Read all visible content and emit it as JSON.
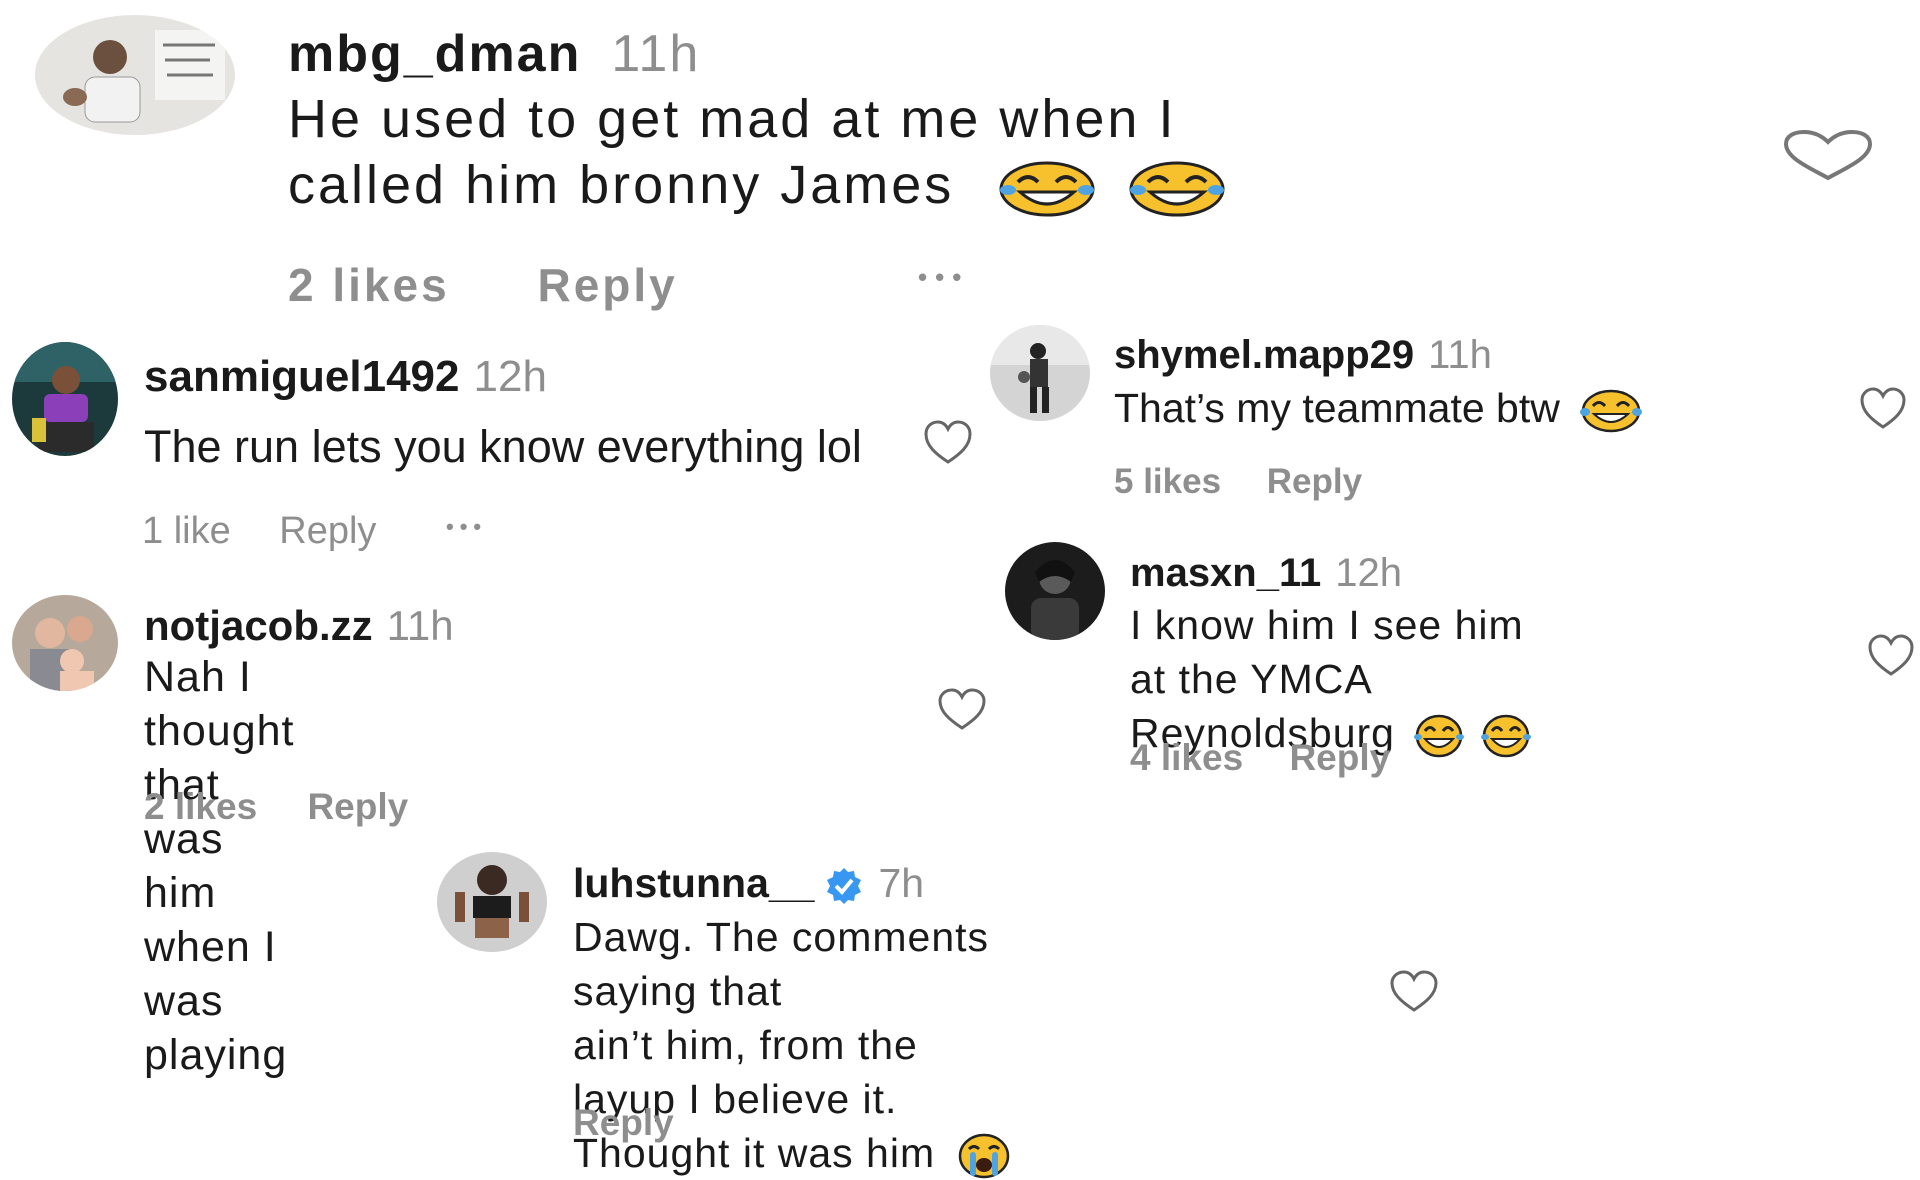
{
  "colors": {
    "text": "#1a1a1a",
    "muted": "#8e8e8e",
    "verified": "#3897f0",
    "emoji_face": "#f6c12d",
    "emoji_tears": "#4fa3e0"
  },
  "icons": {
    "like": "heart-outline-icon",
    "more": "more-dots-icon",
    "verified": "verified-badge-icon",
    "laughing": "face-with-tears-of-joy-icon",
    "crying": "loudly-crying-face-icon"
  },
  "comments": {
    "c1": {
      "username": "mbg_dman",
      "time": "11h",
      "text_line1": "He used to get mad at me when I",
      "text_line2": "called him bronny James",
      "likes": "2 likes",
      "reply": "Reply",
      "more": "•••"
    },
    "c2": {
      "username": "sanmiguel1492",
      "time": "12h",
      "text": "The run lets you know everything lol",
      "likes": "1 like",
      "reply": "Reply",
      "more": "•••"
    },
    "c3": {
      "username": "notjacob.zz",
      "time": "11h",
      "text_line1": "Nah I thought that was him when I",
      "text_line2": "was playing",
      "likes": "2 likes",
      "reply": "Reply"
    },
    "c4": {
      "username": "shymel.mapp29",
      "time": "11h",
      "text": "That’s my teammate btw",
      "likes": "5 likes",
      "reply": "Reply"
    },
    "c5": {
      "username": "masxn_11",
      "time": "12h",
      "text_line1": "I know him I see him at the YMCA",
      "text_line2": "Reynoldsburg",
      "likes": "4 likes",
      "reply": "Reply"
    },
    "c6": {
      "username": "luhstunna__",
      "time": "7h",
      "text_line1": "Dawg. The comments saying that",
      "text_line2": "ain’t him, from the layup I believe it.",
      "text_line3": "Thought it was him",
      "reply": "Reply"
    }
  }
}
